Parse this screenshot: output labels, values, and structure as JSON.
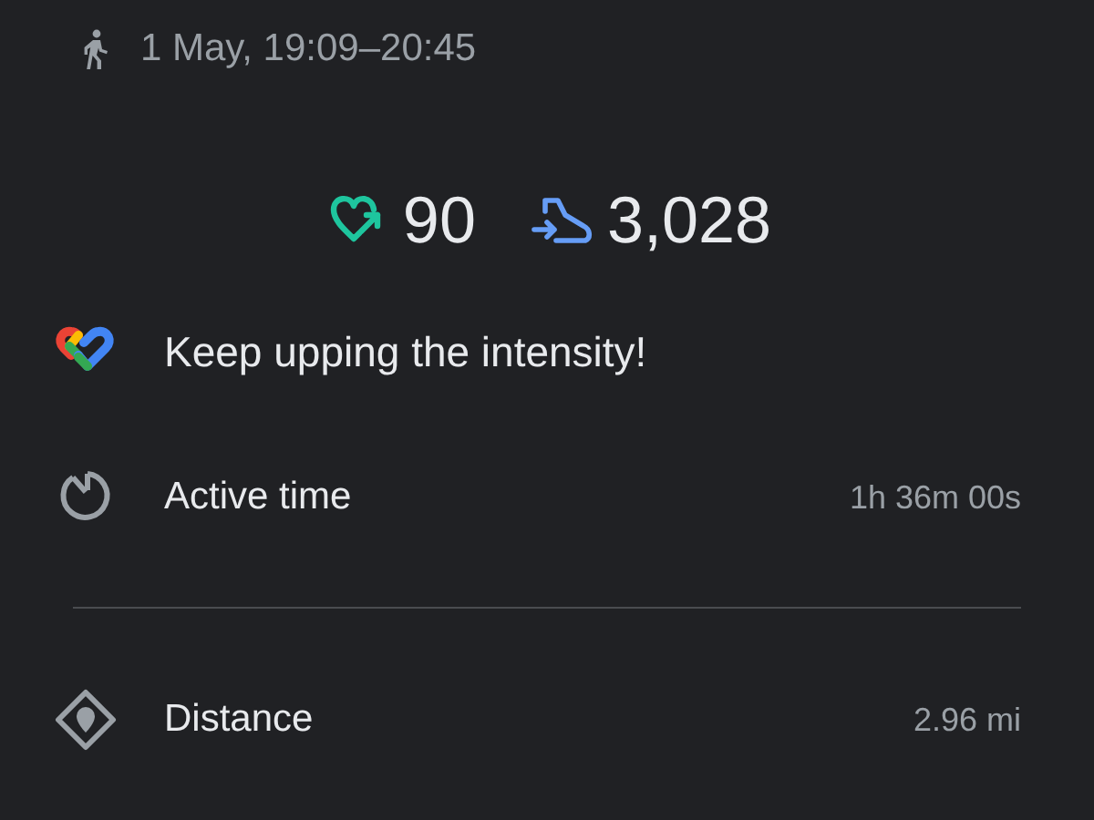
{
  "header": {
    "date_time": "1 May, 19:09–20:45"
  },
  "stats": [
    {
      "kind": "heart_points",
      "value": "90"
    },
    {
      "kind": "steps",
      "value": "3,028"
    }
  ],
  "tip": {
    "text": "Keep upping the intensity!"
  },
  "metrics": [
    {
      "kind": "active_time",
      "label": "Active time",
      "value": "1h 36m 00s"
    },
    {
      "kind": "distance",
      "label": "Distance",
      "value": "2.96 mi"
    }
  ]
}
